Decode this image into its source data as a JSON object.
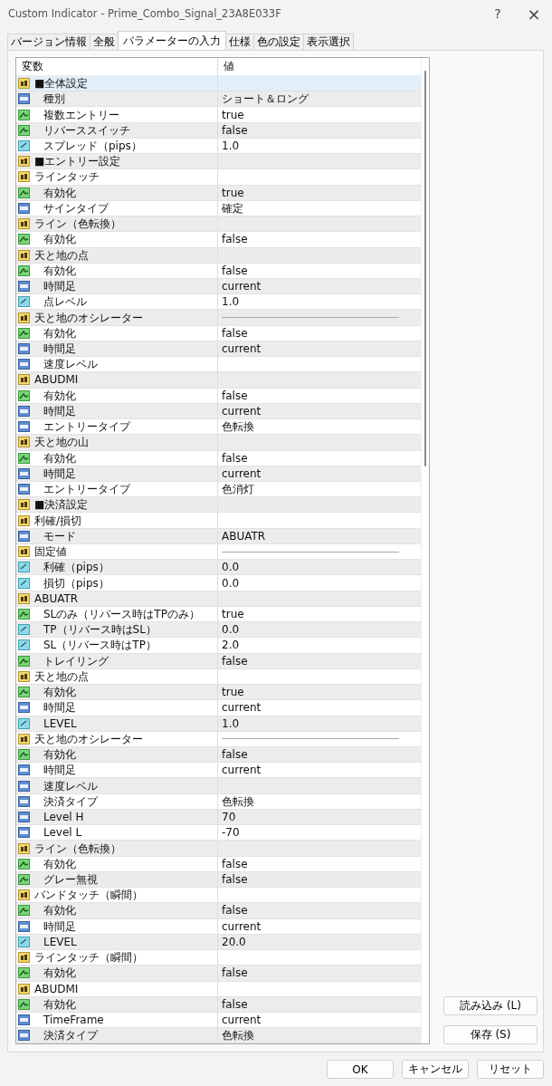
{
  "window": {
    "title": "Custom Indicator - Prime_Combo_Signal_23A8E033F",
    "help": "?",
    "close": "×"
  },
  "tabs": [
    {
      "label": "バージョン情報",
      "selected": false
    },
    {
      "label": "全般",
      "selected": false
    },
    {
      "label": "パラメーターの入力",
      "selected": true
    },
    {
      "label": "仕様",
      "selected": false
    },
    {
      "label": "色の設定",
      "selected": false
    },
    {
      "label": "表示選択",
      "selected": false
    }
  ],
  "table": {
    "columns": [
      "変数",
      "値"
    ],
    "params": [
      {
        "kind": "string",
        "name": "■全体設定",
        "selected": true,
        "children": [
          {
            "kind": "int",
            "name": "種別",
            "value": "ショート＆ロング",
            "selected": false
          },
          {
            "kind": "bool",
            "name": "複数エントリー",
            "value": "true",
            "selected": false
          },
          {
            "kind": "bool",
            "name": "リバーススイッチ",
            "value": "false",
            "selected": false
          },
          {
            "kind": "double",
            "name": "スプレッド（pips）",
            "value": "1.0",
            "selected": false
          }
        ]
      },
      {
        "kind": "string",
        "name": "■エントリー設定",
        "selected": false
      },
      {
        "kind": "string",
        "name": "ラインタッチ",
        "selected": false,
        "children": [
          {
            "kind": "bool",
            "name": "有効化",
            "value": "true",
            "selected": false
          },
          {
            "kind": "int",
            "name": "サインタイプ",
            "value": "確定",
            "selected": false
          }
        ]
      },
      {
        "kind": "string",
        "name": "ライン（色転換）",
        "selected": false,
        "children": [
          {
            "kind": "bool",
            "name": "有効化",
            "value": "false",
            "selected": false
          }
        ]
      },
      {
        "kind": "string",
        "name": "天と地の点",
        "selected": false,
        "children": [
          {
            "kind": "bool",
            "name": "有効化",
            "value": "false",
            "selected": false
          },
          {
            "kind": "int",
            "name": "時間足",
            "value": "current",
            "selected": false
          },
          {
            "kind": "double",
            "name": "点レベル",
            "value": "1.0",
            "selected": false
          }
        ]
      },
      {
        "kind": "string",
        "name": "天と地のオシレーター",
        "rule": true,
        "selected": false,
        "children": [
          {
            "kind": "bool",
            "name": "有効化",
            "value": "false",
            "selected": false
          },
          {
            "kind": "int",
            "name": "時間足",
            "value": "current",
            "selected": false
          },
          {
            "kind": "int",
            "name": "速度レベル",
            "selected": false
          }
        ]
      },
      {
        "kind": "string",
        "name": "ABUDMI",
        "selected": false,
        "children": [
          {
            "kind": "bool",
            "name": "有効化",
            "value": "false",
            "selected": false
          },
          {
            "kind": "int",
            "name": "時間足",
            "value": "current",
            "selected": false
          },
          {
            "kind": "int",
            "name": "エントリータイプ",
            "value": "色転換",
            "selected": false
          }
        ]
      },
      {
        "kind": "string",
        "name": "天と地の山",
        "selected": false,
        "children": [
          {
            "kind": "bool",
            "name": "有効化",
            "value": "false",
            "selected": false
          },
          {
            "kind": "int",
            "name": "時間足",
            "value": "current",
            "selected": false
          },
          {
            "kind": "int",
            "name": "エントリータイプ",
            "value": "色消灯",
            "selected": false
          }
        ]
      },
      {
        "kind": "string",
        "name": "■決済設定",
        "selected": false
      },
      {
        "kind": "string",
        "name": "利確/損切",
        "selected": false,
        "children": [
          {
            "kind": "int",
            "name": "モード",
            "value": "ABUATR",
            "selected": false
          }
        ]
      },
      {
        "kind": "string",
        "name": "固定値",
        "rule": true,
        "selected": false,
        "children": [
          {
            "kind": "double",
            "name": "利確（pips）",
            "value": "0.0",
            "selected": false
          },
          {
            "kind": "double",
            "name": "損切（pips）",
            "value": "0.0",
            "selected": false
          }
        ]
      },
      {
        "kind": "string",
        "name": "ABUATR",
        "selected": false,
        "children": [
          {
            "kind": "bool",
            "name": "SLのみ（リバース時はTPのみ）",
            "value": "true",
            "selected": false
          },
          {
            "kind": "double",
            "name": "TP（リバース時はSL）",
            "value": "0.0",
            "selected": false
          },
          {
            "kind": "double",
            "name": "SL（リバース時はTP）",
            "value": "2.0",
            "selected": false
          },
          {
            "kind": "bool",
            "name": "トレイリング",
            "value": "false",
            "selected": false
          }
        ]
      },
      {
        "kind": "string",
        "name": "天と地の点",
        "selected": false,
        "children": [
          {
            "kind": "bool",
            "name": "有効化",
            "value": "true",
            "selected": false
          },
          {
            "kind": "int",
            "name": "時間足",
            "value": "current",
            "selected": false
          },
          {
            "kind": "double",
            "name": "LEVEL",
            "value": "1.0",
            "selected": false
          }
        ]
      },
      {
        "kind": "string",
        "name": "天と地のオシレーター",
        "rule": true,
        "selected": false,
        "children": [
          {
            "kind": "bool",
            "name": "有効化",
            "value": "false",
            "selected": false
          },
          {
            "kind": "int",
            "name": "時間足",
            "value": "current",
            "selected": false
          },
          {
            "kind": "int",
            "name": "速度レベル",
            "selected": false
          },
          {
            "kind": "int",
            "name": "決済タイプ",
            "value": "色転換",
            "selected": false
          },
          {
            "kind": "int",
            "name": "Level H",
            "value": "70",
            "selected": false
          },
          {
            "kind": "int",
            "name": "Level L",
            "value": "-70",
            "selected": false
          }
        ]
      },
      {
        "kind": "string",
        "name": "ライン（色転換）",
        "selected": false,
        "children": [
          {
            "kind": "bool",
            "name": "有効化",
            "value": "false",
            "selected": false
          },
          {
            "kind": "bool",
            "name": "グレー無視",
            "value": "false",
            "selected": false
          }
        ]
      },
      {
        "kind": "string",
        "name": "バンドタッチ（瞬間）",
        "selected": false,
        "children": [
          {
            "kind": "bool",
            "name": "有効化",
            "value": "false",
            "selected": false
          },
          {
            "kind": "int",
            "name": "時間足",
            "value": "current",
            "selected": false
          },
          {
            "kind": "double",
            "name": "LEVEL",
            "value": "20.0",
            "selected": false
          }
        ]
      },
      {
        "kind": "string",
        "name": "ラインタッチ（瞬間）",
        "selected": false,
        "children": [
          {
            "kind": "bool",
            "name": "有効化",
            "value": "false",
            "selected": false
          }
        ]
      },
      {
        "kind": "string",
        "name": "ABUDMI",
        "selected": false,
        "children": [
          {
            "kind": "bool",
            "name": "有効化",
            "value": "false",
            "selected": false
          },
          {
            "kind": "int",
            "name": "TimeFrame",
            "value": "current",
            "selected": false
          },
          {
            "kind": "int",
            "name": "決済タイプ",
            "value": "色転換",
            "selected": false
          }
        ]
      }
    ]
  },
  "side_buttons": [
    "読み込み (L)",
    "保存 (S)"
  ],
  "buttons": [
    "OK",
    "キャンセル",
    "リセット"
  ]
}
